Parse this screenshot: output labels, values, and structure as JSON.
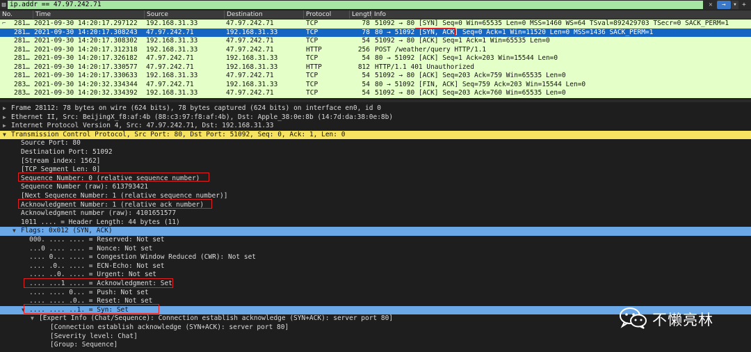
{
  "filter": {
    "value": "ip.addr == 47.97.242.71",
    "apply_label": "→",
    "dropdown_label": "▾",
    "plus_label": "+",
    "clear_label": "✕"
  },
  "columns": [
    "No.",
    "Time",
    "Source",
    "Destination",
    "Protocol",
    "Length",
    "Info"
  ],
  "packets": [
    {
      "no": "281…",
      "time": "2021-09-30 14:20:17.297122",
      "src": "192.168.31.33",
      "dst": "47.97.242.71",
      "proto": "TCP",
      "len": "78",
      "info": "51092 → 80 [SYN] Seq=0 Win=65535 Len=0 MSS=1460 WS=64 TSval=892429703 TSecr=0 SACK_PERM=1",
      "marker": "⌐"
    },
    {
      "no": "281…",
      "time": "2021-09-30 14:20:17.308243",
      "src": "47.97.242.71",
      "dst": "192.168.31.33",
      "proto": "TCP",
      "len": "78",
      "info": "80 → 51092 [SYN, ACK] Seq=0 Ack=1 Win=11520 Len=0 MSS=1436 SACK_PERM=1",
      "marker": ""
    },
    {
      "no": "281…",
      "time": "2021-09-30 14:20:17.308302",
      "src": "192.168.31.33",
      "dst": "47.97.242.71",
      "proto": "TCP",
      "len": "54",
      "info": "51092 → 80 [ACK] Seq=1 Ack=1 Win=65535 Len=0",
      "marker": ""
    },
    {
      "no": "281…",
      "time": "2021-09-30 14:20:17.312318",
      "src": "192.168.31.33",
      "dst": "47.97.242.71",
      "proto": "HTTP",
      "len": "256",
      "info": "POST /weather/query HTTP/1.1",
      "marker": ""
    },
    {
      "no": "281…",
      "time": "2021-09-30 14:20:17.326182",
      "src": "47.97.242.71",
      "dst": "192.168.31.33",
      "proto": "TCP",
      "len": "54",
      "info": "80 → 51092 [ACK] Seq=1 Ack=203 Win=15544 Len=0",
      "marker": ""
    },
    {
      "no": "281…",
      "time": "2021-09-30 14:20:17.330577",
      "src": "47.97.242.71",
      "dst": "192.168.31.33",
      "proto": "HTTP",
      "len": "812",
      "info": "HTTP/1.1 401 Unauthorized",
      "marker": ""
    },
    {
      "no": "281…",
      "time": "2021-09-30 14:20:17.330633",
      "src": "192.168.31.33",
      "dst": "47.97.242.71",
      "proto": "TCP",
      "len": "54",
      "info": "51092 → 80 [ACK] Seq=203 Ack=759 Win=65535 Len=0",
      "marker": ""
    },
    {
      "no": "283…",
      "time": "2021-09-30 14:20:32.334344",
      "src": "47.97.242.71",
      "dst": "192.168.31.33",
      "proto": "TCP",
      "len": "54",
      "info": "80 → 51092 [FIN, ACK] Seq=759 Ack=203 Win=15544 Len=0",
      "marker": ""
    },
    {
      "no": "283…",
      "time": "2021-09-30 14:20:32.334392",
      "src": "192.168.31.33",
      "dst": "47.97.242.71",
      "proto": "TCP",
      "len": "54",
      "info": "51092 → 80 [ACK] Seq=203 Ack=760 Win=65535 Len=0",
      "marker": ""
    }
  ],
  "details": [
    {
      "tw": "▶",
      "text": "Frame 28112: 78 bytes on wire (624 bits), 78 bytes captured (624 bits) on interface en0, id 0"
    },
    {
      "tw": "▶",
      "text": "Ethernet II, Src: BeijingX_f8:af:4b (88:c3:97:f8:af:4b), Dst: Apple_38:0e:8b (14:7d:da:38:0e:8b)"
    },
    {
      "tw": "▶",
      "text": "Internet Protocol Version 4, Src: 47.97.242.71, Dst: 192.168.31.33"
    },
    {
      "tw": "▼",
      "text": "Transmission Control Protocol, Src Port: 80, Dst Port: 51092, Seq: 0, Ack: 1, Len: 0"
    },
    {
      "tw": "",
      "text": "Source Port: 80"
    },
    {
      "tw": "",
      "text": "Destination Port: 51092"
    },
    {
      "tw": "",
      "text": "[Stream index: 1562]"
    },
    {
      "tw": "",
      "text": "[TCP Segment Len: 0]"
    },
    {
      "tw": "",
      "text": "Sequence Number: 0    (relative sequence number)"
    },
    {
      "tw": "",
      "text": "Sequence Number (raw): 613793421"
    },
    {
      "tw": "",
      "text": "[Next Sequence Number: 1    (relative sequence number)]"
    },
    {
      "tw": "",
      "text": "Acknowledgment Number: 1    (relative ack number)"
    },
    {
      "tw": "",
      "text": "Acknowledgment number (raw): 4101651577"
    },
    {
      "tw": "",
      "text": "1011 .... = Header Length: 44 bytes (11)"
    },
    {
      "tw": "▼",
      "text": "Flags: 0x012 (SYN, ACK)"
    },
    {
      "tw": "",
      "text": "000. .... .... = Reserved: Not set"
    },
    {
      "tw": "",
      "text": "...0 .... .... = Nonce: Not set"
    },
    {
      "tw": "",
      "text": ".... 0... .... = Congestion Window Reduced (CWR): Not set"
    },
    {
      "tw": "",
      "text": ".... .0.. .... = ECN-Echo: Not set"
    },
    {
      "tw": "",
      "text": ".... ..0. .... = Urgent: Not set"
    },
    {
      "tw": "",
      "text": ".... ...1 .... = Acknowledgment: Set"
    },
    {
      "tw": "",
      "text": ".... .... 0... = Push: Not set"
    },
    {
      "tw": "",
      "text": ".... .... .0.. = Reset: Not set"
    },
    {
      "tw": "▼",
      "text": ".... .... ..1. = Syn: Set"
    },
    {
      "tw": "▼",
      "text": "[Expert Info (Chat/Sequence): Connection establish acknowledge (SYN+ACK): server port 80]"
    },
    {
      "tw": "",
      "text": "[Connection establish acknowledge (SYN+ACK): server port 80]"
    },
    {
      "tw": "",
      "text": "[Severity level: Chat]"
    },
    {
      "tw": "",
      "text": "[Group: Sequence]"
    }
  ],
  "watermark": {
    "text": "不懒亮林",
    "icon": "wechat-icon"
  },
  "colors": {
    "tcp_row": "#e4ffc7",
    "selected_row": "#1566c3",
    "tcp_header": "#f6e35f",
    "field_selected": "#6aa8e8",
    "filter_valid": "#a8e6a3",
    "annotation": "#e02020"
  }
}
